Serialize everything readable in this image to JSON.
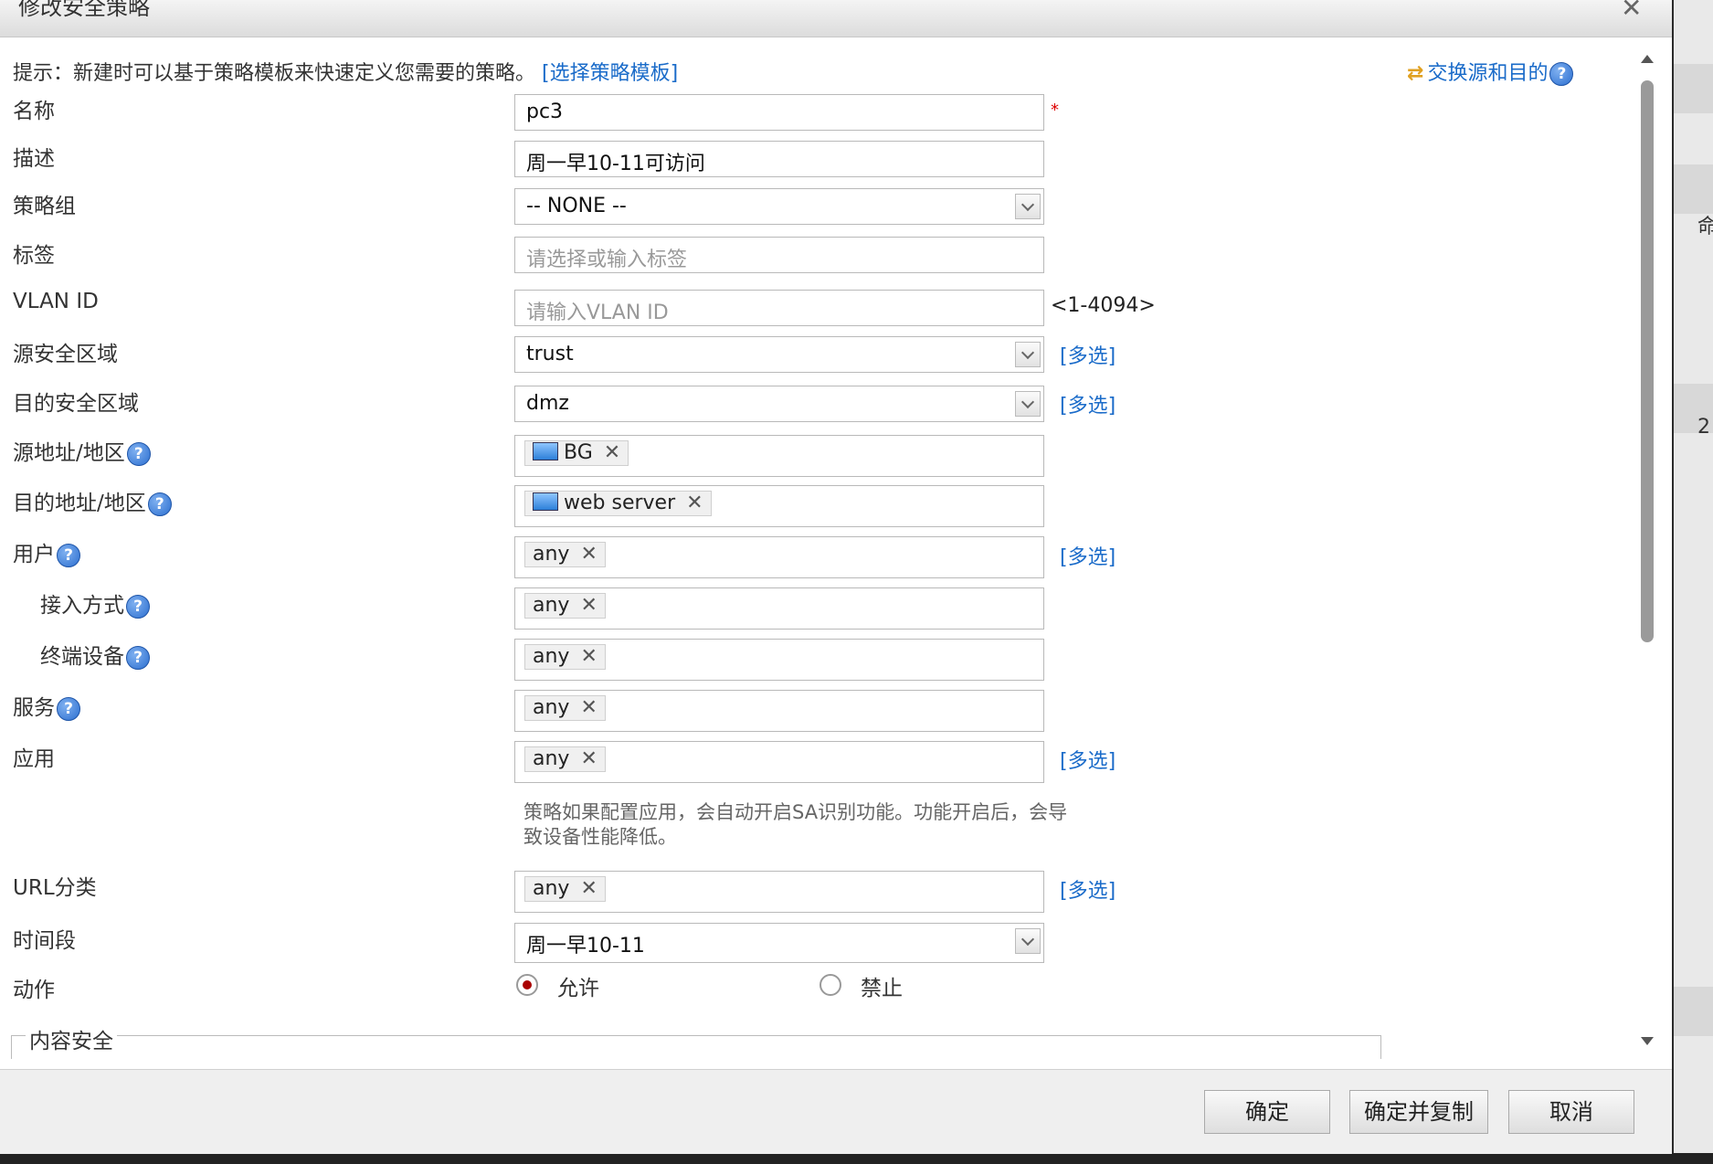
{
  "dialog": {
    "title": "修改安全策略",
    "close": "✕"
  },
  "hint": {
    "text": "提示：新建时可以基于策略模板来快速定义您需要的策略。",
    "link": "[选择策略模板]"
  },
  "swap": {
    "icon": "⇄",
    "label": "交换源和目的"
  },
  "help_glyph": "?",
  "multi_select_label": "[多选]",
  "required_mark": "*",
  "form": {
    "name": {
      "label": "名称",
      "value": "pc3"
    },
    "description": {
      "label": "描述",
      "value": "周一早10-11可访问"
    },
    "policy_group": {
      "label": "策略组",
      "value": "-- NONE --"
    },
    "tags": {
      "label": "标签",
      "placeholder": "请选择或输入标签"
    },
    "vlan": {
      "label": "VLAN ID",
      "placeholder": "请输入VLAN ID",
      "range": "<1-4094>"
    },
    "src_zone": {
      "label": "源安全区域",
      "value": "trust"
    },
    "dst_zone": {
      "label": "目的安全区域",
      "value": "dmz"
    },
    "src_addr": {
      "label": "源地址/地区",
      "tag": "BG"
    },
    "dst_addr": {
      "label": "目的地址/地区",
      "tag": "web server"
    },
    "user": {
      "label": "用户",
      "tag": "any"
    },
    "access_mode": {
      "label": "接入方式",
      "tag": "any"
    },
    "terminal": {
      "label": "终端设备",
      "tag": "any"
    },
    "service": {
      "label": "服务",
      "tag": "any"
    },
    "application": {
      "label": "应用",
      "tag": "any",
      "note": "策略如果配置应用，会自动开启SA识别功能。功能开启后，会导致设备性能降低。"
    },
    "url_category": {
      "label": "URL分类",
      "tag": "any"
    },
    "schedule": {
      "label": "时间段",
      "value": "周一早10-11"
    },
    "action": {
      "label": "动作",
      "options": [
        "允许",
        "禁止"
      ],
      "selected": "允许"
    }
  },
  "content_security": {
    "legend": "内容安全"
  },
  "buttons": {
    "ok": "确定",
    "ok_copy": "确定并复制",
    "cancel": "取消"
  },
  "background": {
    "glyph_top": "命",
    "glyph_bottom": "2"
  }
}
